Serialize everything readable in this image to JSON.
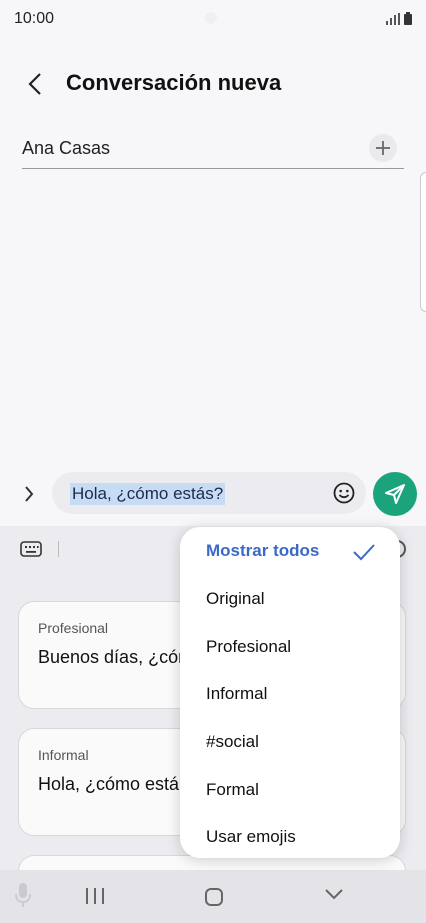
{
  "status_bar": {
    "time": "10:00"
  },
  "header": {
    "title": "Conversación nueva"
  },
  "recipient": {
    "name": "Ana Casas"
  },
  "message": {
    "text": "Hola,  ¿cómo estás?"
  },
  "suggestions": [
    {
      "label": "Profesional",
      "text": "Buenos días, ¿cómo"
    },
    {
      "label": "Informal",
      "text": "Hola, ¿cómo está"
    }
  ],
  "menu": {
    "selected": "Mostrar todos",
    "items": [
      "Original",
      "Profesional",
      "Informal",
      "#social",
      "Formal",
      "Usar emojis"
    ]
  },
  "colors": {
    "accent": "#3a6ac8",
    "send": "#1ba37c",
    "highlight": "#c6dcf5"
  }
}
